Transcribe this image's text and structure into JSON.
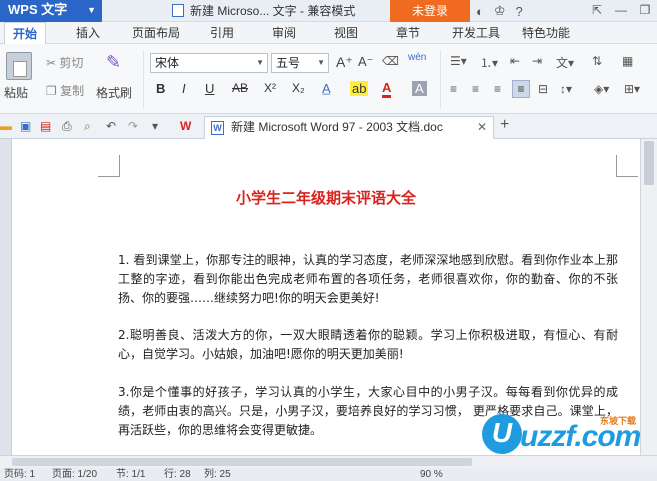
{
  "titlebar": {
    "app_name": "WPS 文字",
    "document_title": "新建 Microso... 文字 - 兼容模式",
    "login_label": "未登录",
    "minimize": "—",
    "restore": "❐",
    "close": "✕"
  },
  "menu": {
    "tabs": [
      {
        "label": "开始"
      },
      {
        "label": "插入"
      },
      {
        "label": "页面布局"
      },
      {
        "label": "引用"
      },
      {
        "label": "审阅"
      },
      {
        "label": "视图"
      },
      {
        "label": "章节"
      },
      {
        "label": "开发工具"
      },
      {
        "label": "特色功能"
      }
    ]
  },
  "ribbon": {
    "paste": "粘贴",
    "cut": "剪切",
    "copy": "复制",
    "format_painter": "格式刷",
    "font_name": "宋体",
    "font_size": "五号",
    "bold": "B",
    "italic": "I",
    "underline": "U",
    "strike": "AB",
    "superscript": "X²",
    "subscript": "X₂",
    "font_color": "A",
    "grow_font": "A⁺",
    "shrink_font": "A⁻",
    "phonetic": "wén"
  },
  "doc_tab": {
    "title": "新建 Microsoft Word 97 - 2003 文档.doc",
    "icon_letter": "W",
    "close": "✕",
    "new_tab": "+"
  },
  "document": {
    "heading": "小学生二年级期末评语大全",
    "paragraphs": [
      "1. 看到课堂上，你那专注的眼神，认真的学习态度，老师深深地感到欣慰。看到你作业本上那工整的字迹，看到你能出色完成老师布置的各项任务，老师很喜欢你，你的勤奋、你的不张扬、你的要强……继续努力吧!你的明天会更美好!",
      "2.聪明善良、活泼大方的你，一双大眼睛透着你的聪颖。学习上你积极进取，有恒心、有耐心，自觉学习。小姑娘，加油吧!愿你的明天更加美丽!",
      "3.你是个懂事的好孩子，学习认真的小学生，大家心目中的小男子汉。每每看到你优异的成绩，老师由衷的高兴。只是，小男子汉，要培养良好的学习习惯，  更严格要求自己。课堂上，再活跃些，你的思维将会变得更敏捷。"
    ]
  },
  "watermark": {
    "brand": "uzzf.com",
    "u_mark": "U",
    "tagline": "东坡下载"
  },
  "status": {
    "page": "页码: 1",
    "pages": "页面: 1/20",
    "section": "节: 1/1",
    "row": "行: 28",
    "col": "列: 25",
    "zoom": "90 %"
  }
}
